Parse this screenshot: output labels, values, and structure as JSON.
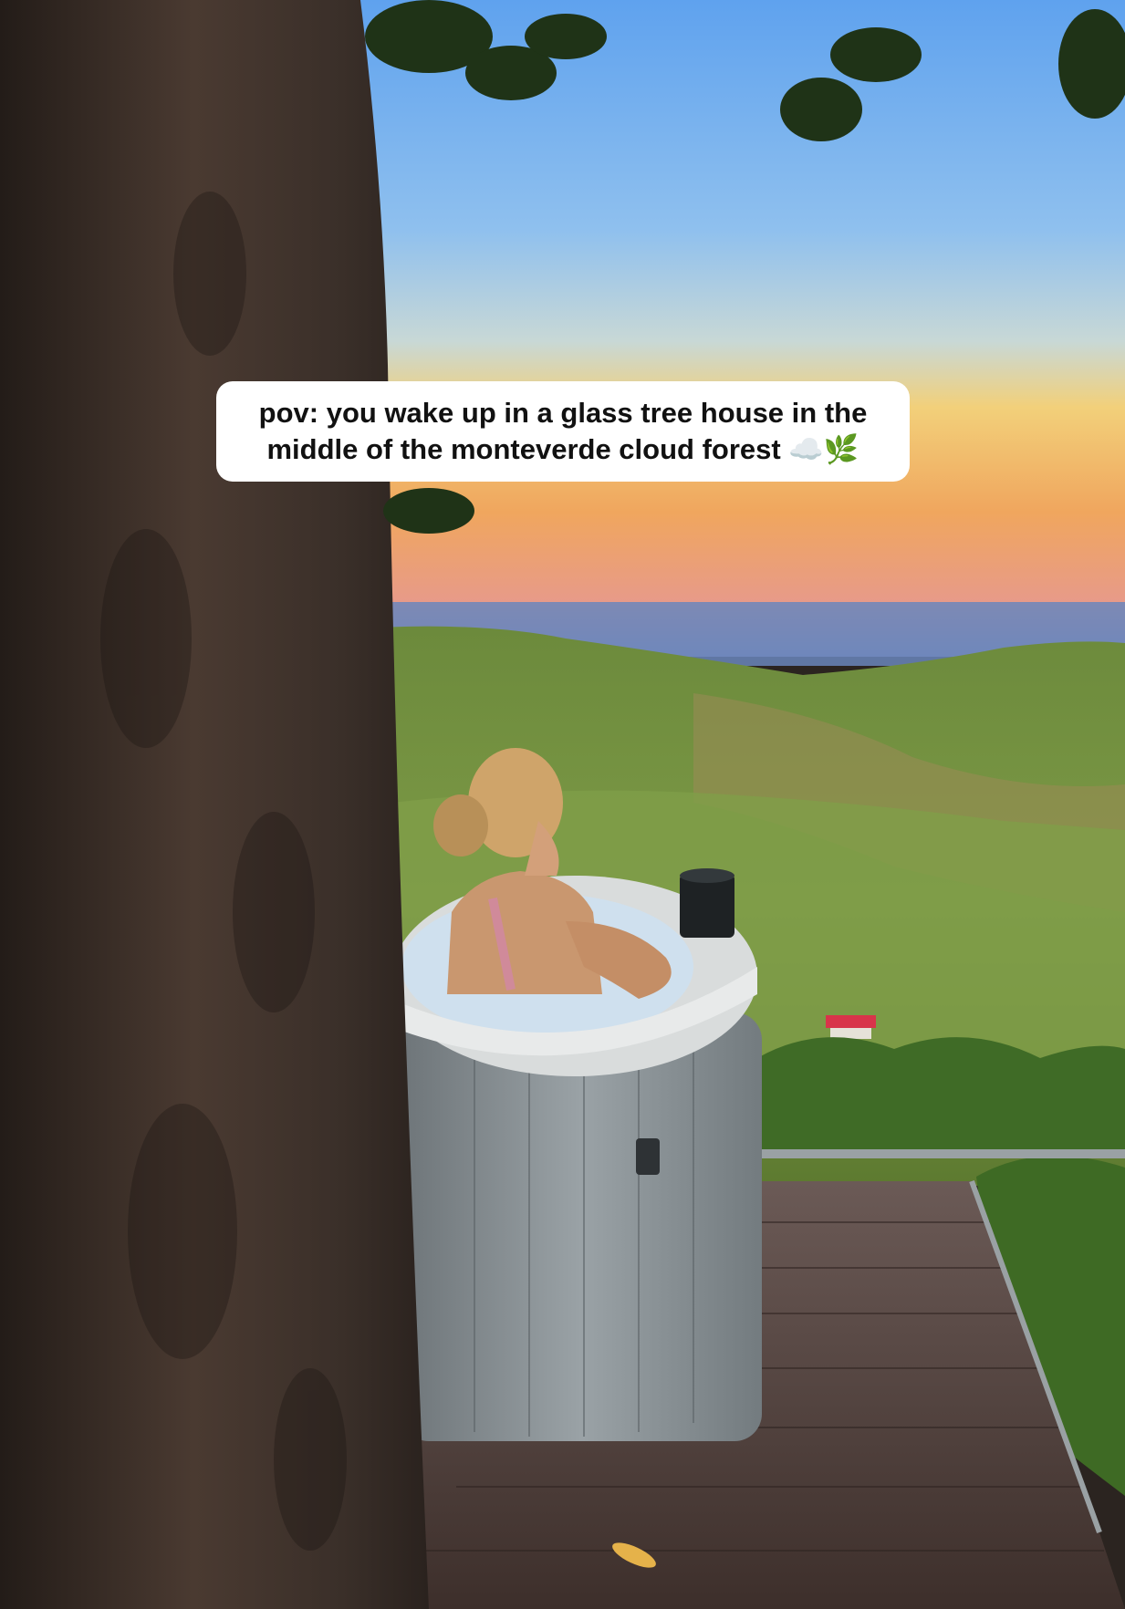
{
  "caption": {
    "text": "pov: you wake up in a glass tree house in the middle of the monteverde cloud forest ☁️🌿"
  },
  "photo": {
    "colors": {
      "sky_top": "#6aa9ee",
      "sky_mid": "#a9cde8",
      "sunset_glow": "#f3c26a",
      "sunset_orange": "#f0a25a",
      "distant_sea": "#5f7fb8",
      "hills": "#6f8f3a",
      "tree_trunk": "#3b302a",
      "hot_tub": "#8c9396",
      "deck": "#4b3a35"
    }
  }
}
